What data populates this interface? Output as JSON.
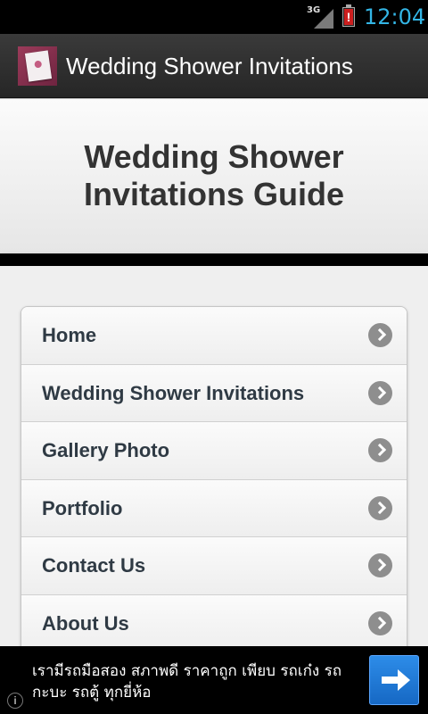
{
  "status_bar": {
    "network": "3G",
    "battery_alert": "!",
    "time": "12:04",
    "colors": {
      "clock": "#33b5e5",
      "battery": "#cc1f1f"
    },
    "icons": [
      "signal-icon",
      "battery-alert-icon"
    ]
  },
  "action_bar": {
    "title": "Wedding Shower Invitations",
    "icon": "app-invitation-icon"
  },
  "banner": {
    "title": "Wedding Shower Invitations Guide"
  },
  "menu": {
    "items": [
      {
        "label": "Home",
        "icon": "chevron-right-icon"
      },
      {
        "label": "Wedding Shower Invitations",
        "icon": "chevron-right-icon"
      },
      {
        "label": "Gallery Photo",
        "icon": "chevron-right-icon"
      },
      {
        "label": "Portfolio",
        "icon": "chevron-right-icon"
      },
      {
        "label": "Contact Us",
        "icon": "chevron-right-icon"
      },
      {
        "label": "About Us",
        "icon": "chevron-right-icon"
      }
    ]
  },
  "ad": {
    "text": "เรามีรถมือสอง สภาพดี ราคาถูก เพียบ รถเก๋ง รถกะบะ รถตู้ ทุกยี่ห้อ",
    "info_glyph": "i",
    "button_icon": "arrow-right-icon",
    "colors": {
      "button": "#1a73d9"
    }
  }
}
